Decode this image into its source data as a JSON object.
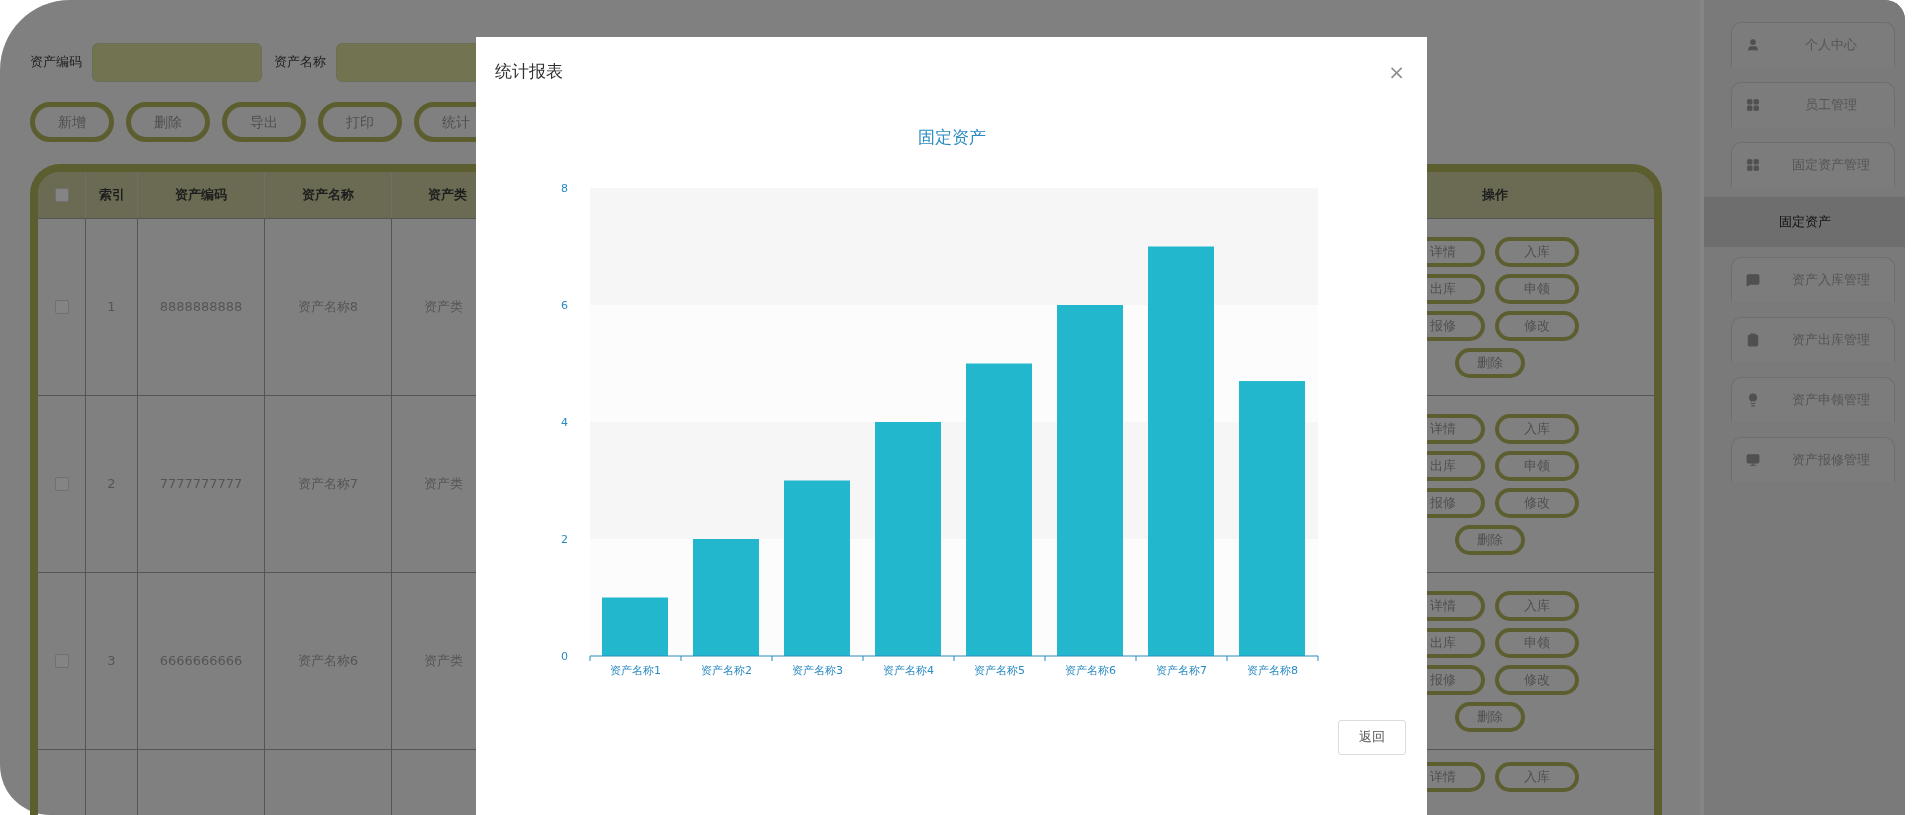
{
  "search": {
    "fields": [
      {
        "label": "资产编码"
      },
      {
        "label": "资产名称"
      }
    ]
  },
  "toolbar": {
    "buttons": [
      "新增",
      "删除",
      "导出",
      "打印",
      "统计"
    ]
  },
  "table": {
    "select_all": {
      "checked": false
    },
    "columns": [
      "索引",
      "资产编码",
      "资产名称",
      "资产类",
      "操作"
    ],
    "rows": [
      {
        "checked": false,
        "index": "1",
        "code": "8888888888",
        "name": "资产名称8",
        "type": "资产类",
        "actions": [
          "详情",
          "入库",
          "出库",
          "申领",
          "报修",
          "修改",
          "删除"
        ]
      },
      {
        "checked": false,
        "index": "2",
        "code": "7777777777",
        "name": "资产名称7",
        "type": "资产类",
        "actions": [
          "详情",
          "入库",
          "出库",
          "申领",
          "报修",
          "修改",
          "删除"
        ]
      },
      {
        "checked": false,
        "index": "3",
        "code": "6666666666",
        "name": "资产名称6",
        "type": "资产类",
        "actions": [
          "详情",
          "入库",
          "出库",
          "申领",
          "报修",
          "修改",
          "删除"
        ]
      },
      {
        "actions": [
          "详情",
          "入库"
        ]
      }
    ]
  },
  "sidebar": {
    "items": [
      {
        "label": "个人中心",
        "selected": false
      },
      {
        "label": "员工管理",
        "selected": false
      },
      {
        "label": "固定资产管理",
        "selected": false,
        "children": [
          {
            "label": "固定资产",
            "selected": true
          }
        ]
      },
      {
        "label": "资产入库管理",
        "selected": false
      },
      {
        "label": "资产出库管理",
        "selected": false
      },
      {
        "label": "资产申领管理",
        "selected": false
      },
      {
        "label": "资产报修管理",
        "selected": false
      }
    ]
  },
  "dialog": {
    "title": "统计报表",
    "close": "×",
    "chart_data": {
      "type": "bar",
      "title": "固定资产",
      "categories": [
        "资产名称1",
        "资产名称2",
        "资产名称3",
        "资产名称4",
        "资产名称5",
        "资产名称6",
        "资产名称7",
        "资产名称8"
      ],
      "series": [
        {
          "color": "#23b7cd",
          "values": [
            1,
            2,
            3,
            4,
            5,
            6,
            7,
            4.7
          ]
        }
      ],
      "ylim": [
        0,
        8
      ],
      "yticks": [
        0,
        2,
        4,
        6,
        8
      ]
    },
    "buttons": [
      "返回"
    ]
  }
}
